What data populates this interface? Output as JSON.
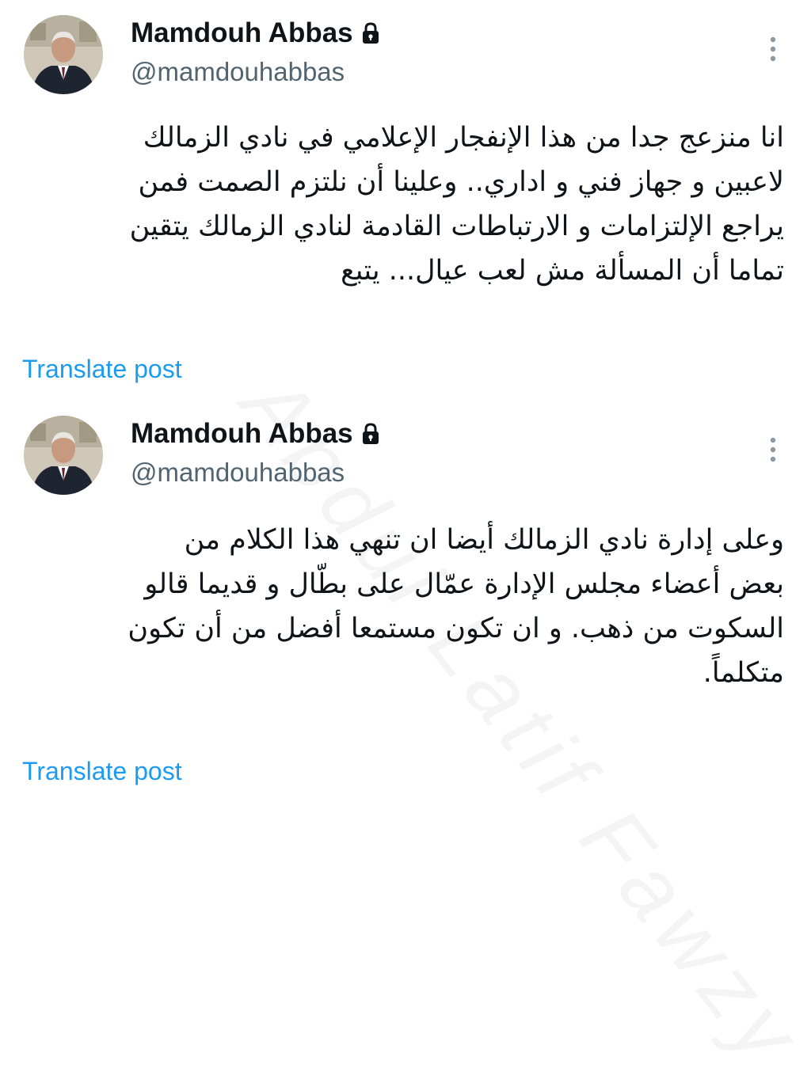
{
  "watermark": "Abdul Latif Fawzy",
  "colors": {
    "name": "#0f1419",
    "handle": "#536471",
    "link": "#1d9bf0",
    "text": "#0f1419"
  },
  "posts": [
    {
      "author": {
        "name": "Mamdouh Abbas",
        "handle": "@mamdouhabbas",
        "protected_icon": "lock-icon"
      },
      "text_lines": [
        "انا منزعج جدا من هذا الإنفجار الإعلامي في نادي الزمالك",
        "لاعبين و جهاز فني و اداري.. وعلينا أن نلتزم الصمت فمن",
        "يراجع الإلتزامات و الارتباطات القادمة لنادي الزمالك يتقين",
        "تماما أن المسألة مش لعب عيال... يتبع"
      ],
      "translate_label": "Translate post",
      "more_icon": "more-vertical-icon"
    },
    {
      "author": {
        "name": "Mamdouh Abbas",
        "handle": "@mamdouhabbas",
        "protected_icon": "lock-icon"
      },
      "text_lines": [
        "وعلى إدارة نادي الزمالك أيضا ان تنهي هذا الكلام من",
        "بعض أعضاء مجلس الإدارة عمّال على بطّال و قديما قالو",
        "السكوت من ذهب. و ان تكون مستمعا أفضل من أن تكون",
        "متكلماً."
      ],
      "translate_label": "Translate post",
      "more_icon": "more-vertical-icon"
    }
  ]
}
